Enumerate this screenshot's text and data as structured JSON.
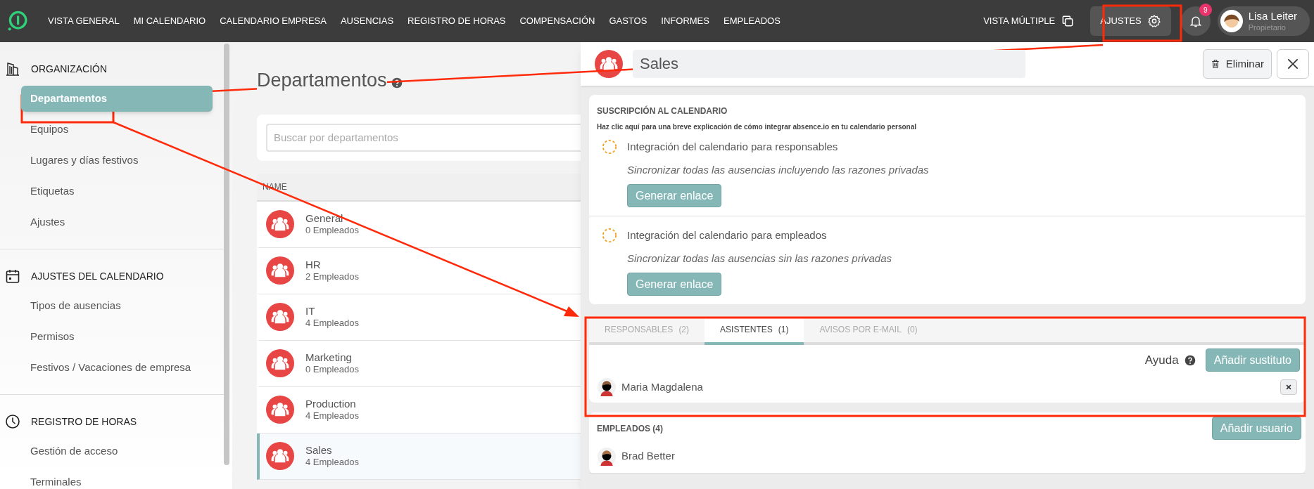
{
  "topbar": {
    "nav": [
      {
        "label": "VISTA GENERAL"
      },
      {
        "label": "MI CALENDARIO"
      },
      {
        "label": "CALENDARIO EMPRESA"
      },
      {
        "label": "AUSENCIAS"
      },
      {
        "label": "REGISTRO DE HORAS"
      },
      {
        "label": "COMPENSACIÓN"
      },
      {
        "label": "GASTOS"
      },
      {
        "label": "INFORMES"
      },
      {
        "label": "EMPLEADOS"
      }
    ],
    "multi_view": "VISTA MÚLTIPLE",
    "settings": "AJUSTES",
    "notifications": "9",
    "user": {
      "name": "Lisa Leiter",
      "role": "Propietario"
    }
  },
  "sidebar": {
    "sections": [
      {
        "kind": "building",
        "title": "ORGANIZACIÓN",
        "items": [
          {
            "label": "Departamentos",
            "selected": true
          },
          {
            "label": "Equipos",
            "selected": false
          },
          {
            "label": "Lugares y días festivos",
            "selected": false
          },
          {
            "label": "Etiquetas",
            "selected": false
          },
          {
            "label": "Ajustes",
            "selected": false
          }
        ]
      },
      {
        "kind": "calendar",
        "title": "AJUSTES DEL CALENDARIO",
        "items": [
          {
            "label": "Tipos de ausencias",
            "selected": false
          },
          {
            "label": "Permisos",
            "selected": false
          },
          {
            "label": "Festivos / Vacaciones de empresa",
            "selected": false
          }
        ]
      },
      {
        "kind": "clock",
        "title": "REGISTRO DE HORAS",
        "items": [
          {
            "label": "Gestión de acceso",
            "selected": false
          },
          {
            "label": "Terminales",
            "selected": false
          }
        ]
      }
    ]
  },
  "main": {
    "title": "Departamentos",
    "search": {
      "placeholder": "Buscar por departamentos"
    },
    "columns": [
      "NAME"
    ],
    "rows": [
      {
        "name": "General",
        "count": "0 Empleados",
        "selected": false
      },
      {
        "name": "HR",
        "count": "2 Empleados",
        "selected": false
      },
      {
        "name": "IT",
        "count": "4 Empleados",
        "selected": false
      },
      {
        "name": "Marketing",
        "count": "0 Empleados",
        "selected": false
      },
      {
        "name": "Production",
        "count": "4 Empleados",
        "selected": false
      },
      {
        "name": "Sales",
        "count": "4 Empleados",
        "selected": true
      }
    ]
  },
  "panel": {
    "name": "Sales",
    "delete": "Eliminar",
    "subscription": {
      "title": "SUSCRIPCIÓN AL CALENDARIO",
      "help": "Haz clic **aquí** para una breve explicación de cómo integrar absence.io en tu calendario personal",
      "integrations": [
        {
          "title": "Integración del calendario para responsables",
          "description": "Sincronizar todas las ausencias incluyendo las razones privadas",
          "button": "Generar enlace"
        },
        {
          "title": "Integración del calendario para empleados",
          "description": "Sincronizar todas las ausencias sin las razones privadas",
          "button": "Generar enlace"
        }
      ]
    },
    "tabs": [
      {
        "label": "RESPONSABLES",
        "count": "(2)",
        "selected": false
      },
      {
        "label": "ASISTENTES",
        "count": "(1)",
        "selected": true
      },
      {
        "label": "AVISOS POR E-MAIL",
        "count": "(0)",
        "selected": false
      }
    ],
    "help": "Ayuda",
    "add_substitute": "Añadir sustituto",
    "assistants": [
      {
        "name": "Maria Magdalena"
      }
    ],
    "employees": {
      "title": "EMPLEADOS (4)",
      "add": "Añadir usuario",
      "list": [
        {
          "name": "Brad Better"
        }
      ]
    }
  }
}
